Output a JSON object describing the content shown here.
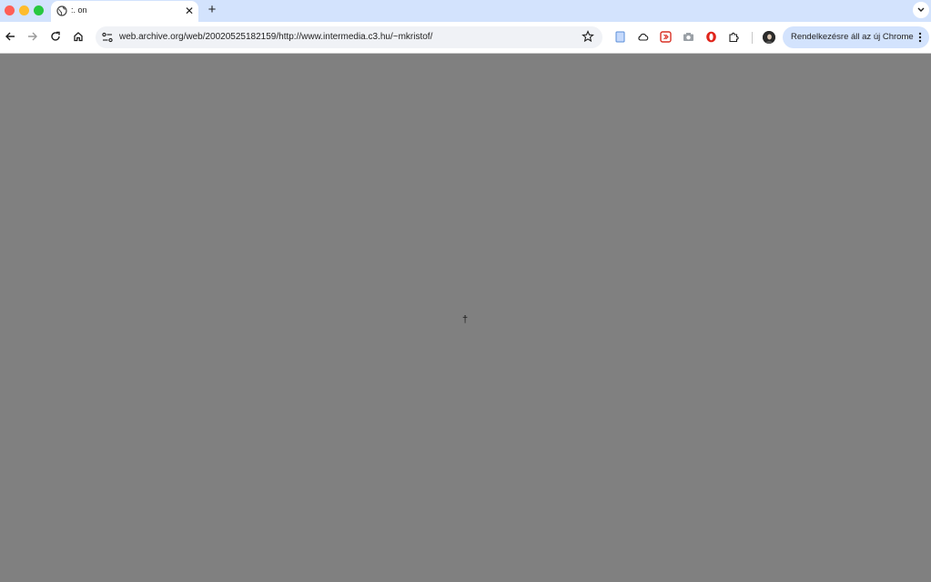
{
  "browser": {
    "tab": {
      "title": ":. on",
      "favicon": "globe-icon"
    },
    "toolbar": {
      "url": "web.archive.org/web/20020525182159/http://www.intermedia.c3.hu/~mkristof/",
      "update_label": "Rendelkezésre áll az új Chrome"
    },
    "icons": {
      "back": "arrow-left-icon",
      "forward": "arrow-right-icon",
      "reload": "reload-icon",
      "home": "home-icon",
      "site_info": "tune-icon",
      "bookmark": "star-icon",
      "extensions": [
        "document-icon",
        "cloud-icon",
        "red-square-extension-icon",
        "camera-icon",
        "opera-icon",
        "puzzle-icon"
      ],
      "profile": "avatar",
      "menu": "more-vert-icon"
    }
  },
  "page": {
    "background": "#808080",
    "center_glyph": "†"
  },
  "colors": {
    "tabstrip": "#d3e3fd",
    "update_button": "#d3e3fd",
    "omnibox": "#f0f2f6"
  }
}
